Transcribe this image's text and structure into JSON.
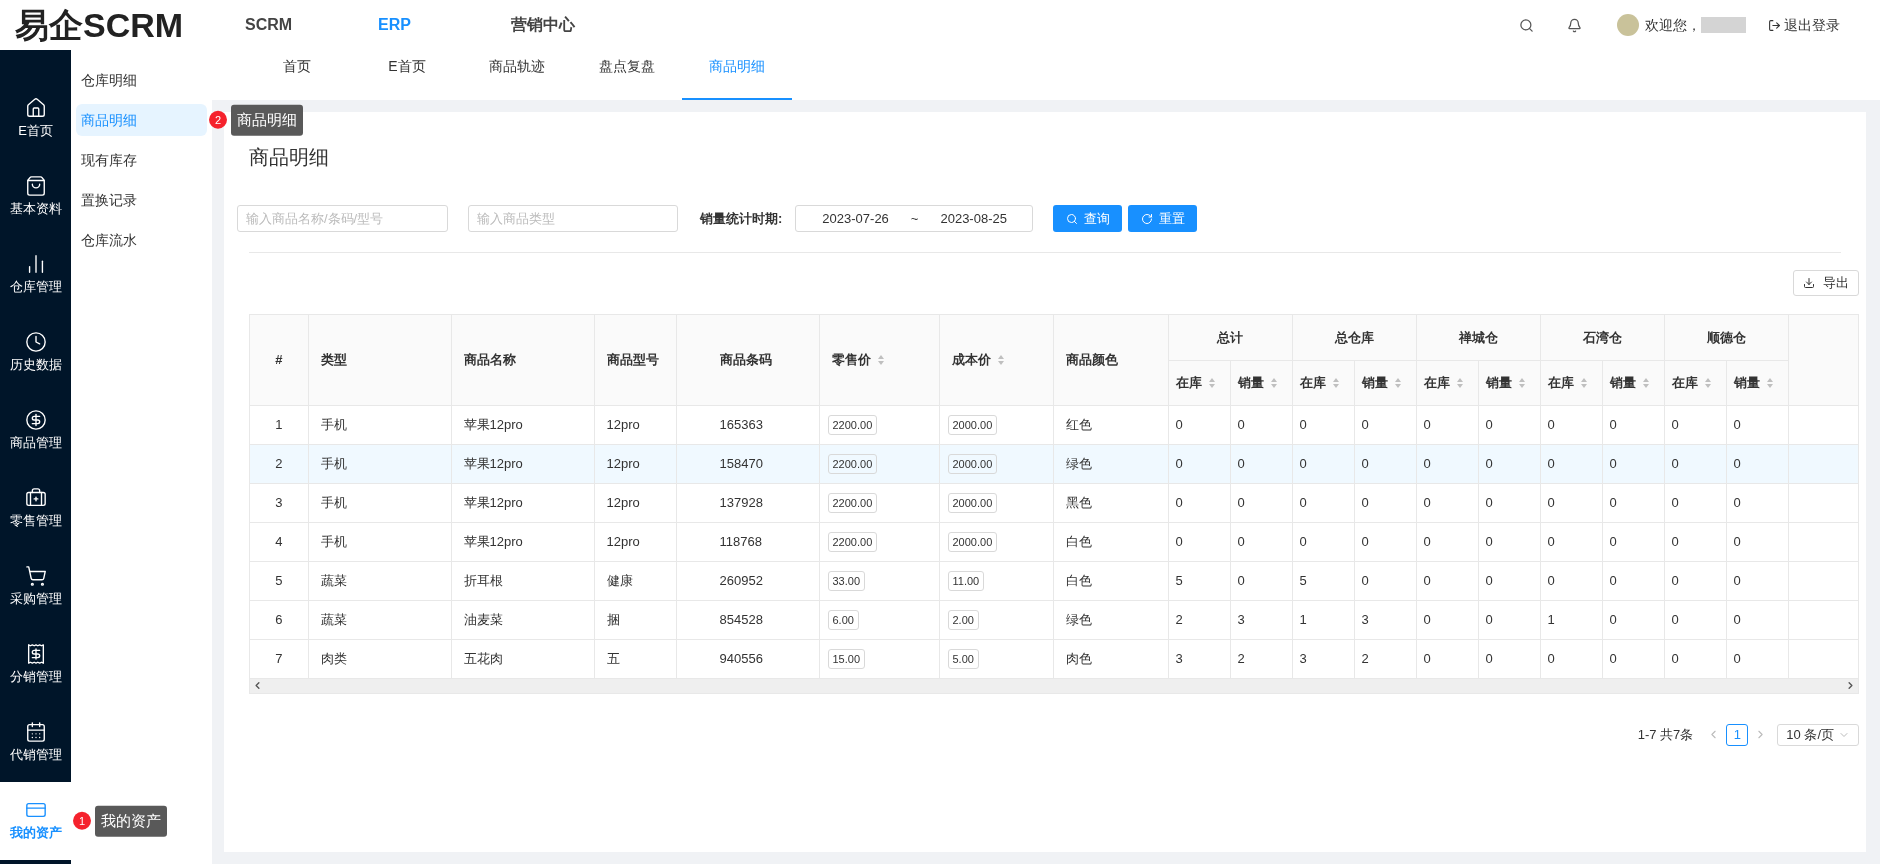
{
  "header": {
    "logo": "易企SCRM",
    "nav": [
      {
        "label": "SCRM",
        "selected": false
      },
      {
        "label": "ERP",
        "selected": true
      },
      {
        "label": "营销中心",
        "selected": false
      }
    ],
    "greeting": "欢迎您，",
    "logout": "退出登录"
  },
  "sidebar": {
    "items": [
      {
        "label": "E首页",
        "selected": false
      },
      {
        "label": "基本资料",
        "selected": false
      },
      {
        "label": "仓库管理",
        "selected": false
      },
      {
        "label": "历史数据",
        "selected": false
      },
      {
        "label": "商品管理",
        "selected": false
      },
      {
        "label": "零售管理",
        "selected": false
      },
      {
        "label": "采购管理",
        "selected": false
      },
      {
        "label": "分销管理",
        "selected": false
      },
      {
        "label": "代销管理",
        "selected": false
      },
      {
        "label": "我的资产",
        "selected": true,
        "tooltip": {
          "badge": "1",
          "text": "我的资产"
        }
      }
    ]
  },
  "submenu": {
    "items": [
      {
        "label": "仓库明细",
        "selected": false
      },
      {
        "label": "商品明细",
        "selected": true,
        "tooltip": {
          "badge": "2",
          "text": "商品明细"
        }
      },
      {
        "label": "现有库存",
        "selected": false
      },
      {
        "label": "置换记录",
        "selected": false
      },
      {
        "label": "仓库流水",
        "selected": false
      }
    ]
  },
  "tabs": [
    {
      "label": "首页",
      "selected": false
    },
    {
      "label": "E首页",
      "selected": false
    },
    {
      "label": "商品轨迹",
      "selected": false
    },
    {
      "label": "盘点复盘",
      "selected": false
    },
    {
      "label": "商品明细",
      "selected": true
    }
  ],
  "page": {
    "title": "商品明细",
    "filters": {
      "name_placeholder": "输入商品名称/条码/型号",
      "type_placeholder": "输入商品类型",
      "period_label": "销量统计时期:",
      "start_date": "2023-07-26",
      "separator": "~",
      "end_date": "2023-08-25",
      "search_button": "查询",
      "reset_button": "重置"
    },
    "export_button": "导出"
  },
  "table": {
    "columns": [
      {
        "label": "#",
        "sortable": false
      },
      {
        "label": "类型",
        "sortable": false
      },
      {
        "label": "商品名称",
        "sortable": false
      },
      {
        "label": "商品型号",
        "sortable": false
      },
      {
        "label": "商品条码",
        "sortable": false
      },
      {
        "label": "零售价",
        "sortable": true
      },
      {
        "label": "成本价",
        "sortable": true
      },
      {
        "label": "商品颜色",
        "sortable": false
      }
    ],
    "groups": [
      {
        "label": "总计",
        "columns": [
          "在库",
          "销量"
        ]
      },
      {
        "label": "总仓库",
        "columns": [
          "在库",
          "销量"
        ]
      },
      {
        "label": "禅城仓",
        "columns": [
          "在库",
          "销量"
        ]
      },
      {
        "label": "石湾仓",
        "columns": [
          "在库",
          "销量"
        ]
      },
      {
        "label": "顺德仓",
        "columns": [
          "在库",
          "销量"
        ]
      }
    ],
    "rows": [
      {
        "index": "1",
        "type": "手机",
        "name": "苹果12pro",
        "model": "12pro",
        "barcode": "165363",
        "retail_price": "2200.00",
        "cost_price": "2000.00",
        "product_color": "红色",
        "selected": false,
        "counts": [
          "0",
          "0",
          "0",
          "0",
          "0",
          "0",
          "0",
          "0",
          "0",
          "0"
        ]
      },
      {
        "index": "2",
        "type": "手机",
        "name": "苹果12pro",
        "model": "12pro",
        "barcode": "158470",
        "retail_price": "2200.00",
        "cost_price": "2000.00",
        "product_color": "绿色",
        "selected": true,
        "counts": [
          "0",
          "0",
          "0",
          "0",
          "0",
          "0",
          "0",
          "0",
          "0",
          "0"
        ]
      },
      {
        "index": "3",
        "type": "手机",
        "name": "苹果12pro",
        "model": "12pro",
        "barcode": "137928",
        "retail_price": "2200.00",
        "cost_price": "2000.00",
        "product_color": "黑色",
        "selected": false,
        "counts": [
          "0",
          "0",
          "0",
          "0",
          "0",
          "0",
          "0",
          "0",
          "0",
          "0"
        ]
      },
      {
        "index": "4",
        "type": "手机",
        "name": "苹果12pro",
        "model": "12pro",
        "barcode": "118768",
        "retail_price": "2200.00",
        "cost_price": "2000.00",
        "product_color": "白色",
        "selected": false,
        "counts": [
          "0",
          "0",
          "0",
          "0",
          "0",
          "0",
          "0",
          "0",
          "0",
          "0"
        ]
      },
      {
        "index": "5",
        "type": "蔬菜",
        "name": "折耳根",
        "model": "健康",
        "barcode": "260952",
        "retail_price": "33.00",
        "cost_price": "11.00",
        "product_color": "白色",
        "selected": false,
        "counts": [
          "5",
          "0",
          "5",
          "0",
          "0",
          "0",
          "0",
          "0",
          "0",
          "0"
        ]
      },
      {
        "index": "6",
        "type": "蔬菜",
        "name": "油麦菜",
        "model": "捆",
        "barcode": "854528",
        "retail_price": "6.00",
        "cost_price": "2.00",
        "product_color": "绿色",
        "selected": false,
        "counts": [
          "2",
          "3",
          "1",
          "3",
          "0",
          "0",
          "1",
          "0",
          "0",
          "0"
        ]
      },
      {
        "index": "7",
        "type": "肉类",
        "name": "五花肉",
        "model": "五",
        "barcode": "940556",
        "retail_price": "15.00",
        "cost_price": "5.00",
        "product_color": "肉色",
        "selected": false,
        "counts": [
          "3",
          "2",
          "3",
          "2",
          "0",
          "0",
          "0",
          "0",
          "0",
          "0"
        ]
      }
    ]
  },
  "pagination": {
    "summary": "1-7 共7条",
    "pages": [
      {
        "label": "1",
        "selected": true
      }
    ],
    "page_size": "10 条/页"
  }
}
